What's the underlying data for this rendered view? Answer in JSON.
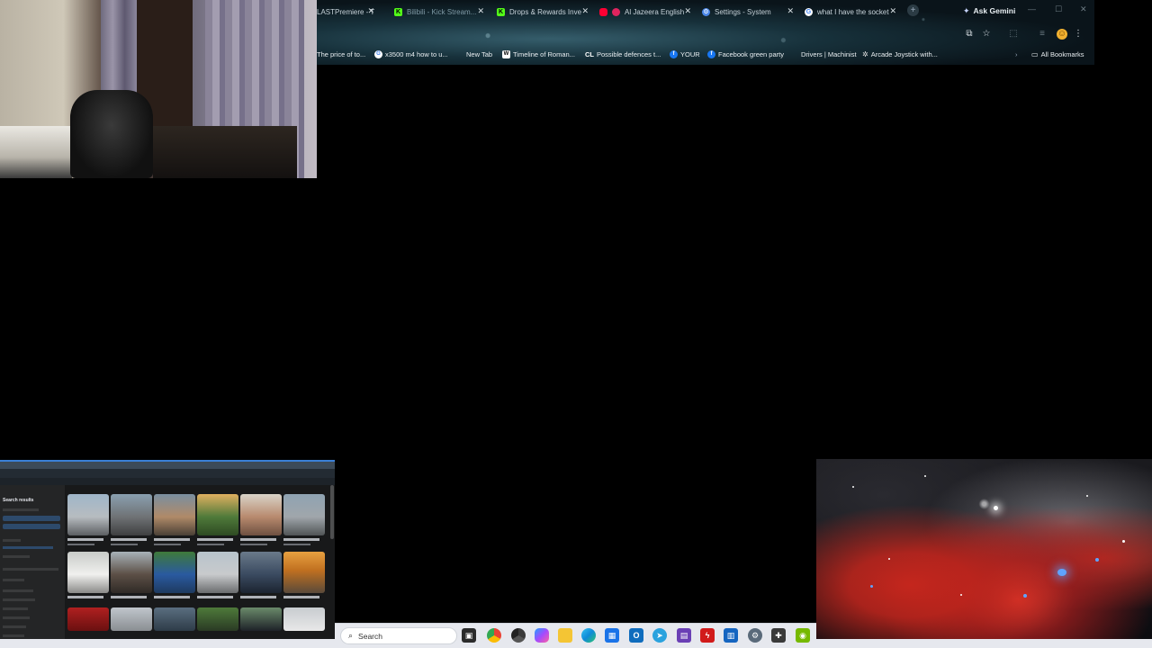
{
  "browser": {
    "tabs": [
      {
        "title": "LASTPremiere - Tv...",
        "favicon": "page-icon",
        "color": "#6b8a96"
      },
      {
        "title": "Bilibili - Kick Stream...",
        "favicon": "kick-icon",
        "color": "#53fc18"
      },
      {
        "title": "Drops & Rewards Inve",
        "favicon": "kick-icon",
        "color": "#53fc18"
      },
      {
        "title": "Al Jazeera English",
        "favicon": "youtube-icon",
        "color": "#ff0033"
      },
      {
        "title": "Settings - System",
        "favicon": "gear-icon",
        "color": "#4a86e8"
      },
      {
        "title": "what I have the socket",
        "favicon": "google-icon",
        "color": "#ffffff"
      }
    ],
    "ask_gemini": "Ask Gemini",
    "bookmarks": [
      {
        "label": "The price of to...",
        "icon": "page-icon",
        "color": "#5a6a72"
      },
      {
        "label": "x3500 m4 how to u...",
        "icon": "google-icon",
        "color": "#ffffff"
      },
      {
        "label": "New Tab",
        "icon": "page-icon",
        "color": "#5a6a72"
      },
      {
        "label": "Timeline of Roman...",
        "icon": "wikipedia-icon",
        "color": "#ffffff"
      },
      {
        "label": "Possible defences t...",
        "icon": "cl-icon",
        "color": "#222"
      },
      {
        "label": "YOUR",
        "icon": "facebook-icon",
        "color": "#1877f2"
      },
      {
        "label": "Facebook green party",
        "icon": "facebook-icon",
        "color": "#1877f2"
      },
      {
        "label": "Drivers | Machinist",
        "icon": "page-icon",
        "color": "#5a6a72"
      },
      {
        "label": "Arcade Joystick with...",
        "icon": "gear-icon",
        "color": "#ccc"
      }
    ],
    "all_bookmarks": "All Bookmarks"
  },
  "share": {
    "heading": "Search results"
  },
  "taskbar": {
    "search_label": "Search",
    "apps": [
      {
        "name": "task-view-icon",
        "color": "#2b2b2b"
      },
      {
        "name": "chrome-icon",
        "color": "#2f8f46"
      },
      {
        "name": "chrome-icon",
        "color": "#1a73e8"
      },
      {
        "name": "copilot-icon",
        "color": "#7b5cd6"
      },
      {
        "name": "file-explorer-icon",
        "color": "#f4c534"
      },
      {
        "name": "edge-icon",
        "color": "#0f8ad7"
      },
      {
        "name": "store-icon",
        "color": "#1a73e8"
      },
      {
        "name": "outlook-icon",
        "color": "#0f6cbd"
      },
      {
        "name": "telegram-icon",
        "color": "#2aa2de"
      },
      {
        "name": "app-icon",
        "color": "#6a3fb5"
      },
      {
        "name": "flash-icon",
        "color": "#d11a1a"
      },
      {
        "name": "app-icon",
        "color": "#1565c0"
      },
      {
        "name": "settings-icon",
        "color": "#5a6a7a"
      },
      {
        "name": "controller-icon",
        "color": "#3a3a3a"
      },
      {
        "name": "nvidia-icon",
        "color": "#76b900"
      }
    ]
  }
}
